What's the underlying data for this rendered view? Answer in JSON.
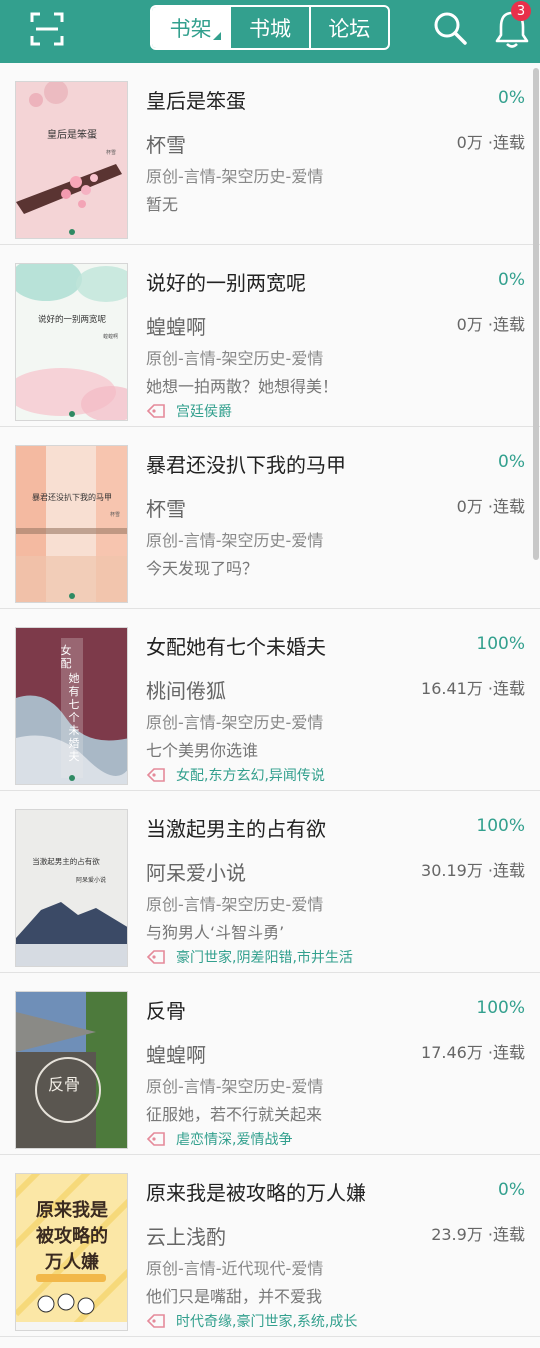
{
  "header": {
    "tabs": [
      {
        "label": "书架",
        "active": true
      },
      {
        "label": "书城",
        "active": false
      },
      {
        "label": "论坛",
        "active": false
      }
    ],
    "notification_count": "3",
    "accent_color": "#33a08e"
  },
  "books": [
    {
      "title": "皇后是笨蛋",
      "progress": "0%",
      "author": "杯雪",
      "stats": "0万 ·连载",
      "genre": "原创-言情-架空历史-爱情",
      "desc": "暂无",
      "tags": "",
      "cover_title": "皇后是笨蛋",
      "cover_author": "杯雪"
    },
    {
      "title": "说好的一别两宽呢",
      "progress": "0%",
      "author": "蝗蝗啊",
      "stats": "0万 ·连载",
      "genre": "原创-言情-架空历史-爱情",
      "desc": "她想一拍两散？她想得美！",
      "tags": "宫廷侯爵",
      "cover_title": "说好的一别两宽呢",
      "cover_author": "蝗蝗啊"
    },
    {
      "title": "暴君还没扒下我的马甲",
      "progress": "0%",
      "author": "杯雪",
      "stats": "0万 ·连载",
      "genre": "原创-言情-架空历史-爱情",
      "desc": "今天发现了吗？",
      "tags": "",
      "cover_title": "暴君还没扒下我的马甲",
      "cover_author": "杯雪"
    },
    {
      "title": "女配她有七个未婚夫",
      "progress": "100%",
      "author": "桃间倦狐",
      "stats": "16.41万 ·连载",
      "genre": "原创-言情-架空历史-爱情",
      "desc": "七个美男你选谁",
      "tags": "女配,东方玄幻,异闻传说",
      "cover_title": "女配她有七个未婚夫",
      "cover_author": ""
    },
    {
      "title": "当激起男主的占有欲",
      "progress": "100%",
      "author": "阿呆爱小说",
      "stats": "30.19万 ·连载",
      "genre": "原创-言情-架空历史-爱情",
      "desc": "与狗男人‘斗智斗勇’",
      "tags": "豪门世家,阴差阳错,市井生活",
      "cover_title": "当激起男主的占有欲",
      "cover_author": "阿呆爱小说"
    },
    {
      "title": "反骨",
      "progress": "100%",
      "author": "蝗蝗啊",
      "stats": "17.46万 ·连载",
      "genre": "原创-言情-架空历史-爱情",
      "desc": "征服她，若不行就关起来",
      "tags": "虐恋情深,爱情战争",
      "cover_title": "反骨",
      "cover_author": ""
    },
    {
      "title": "原来我是被攻略的万人嫌",
      "progress": "0%",
      "author": "云上浅酌",
      "stats": "23.9万 ·连载",
      "genre": "原创-言情-近代现代-爱情",
      "desc": "他们只是嘴甜，并不爱我",
      "tags": "时代奇缘,豪门世家,系统,成长",
      "cover_title": "原来我是被攻略的万人嫌",
      "cover_author": ""
    }
  ]
}
